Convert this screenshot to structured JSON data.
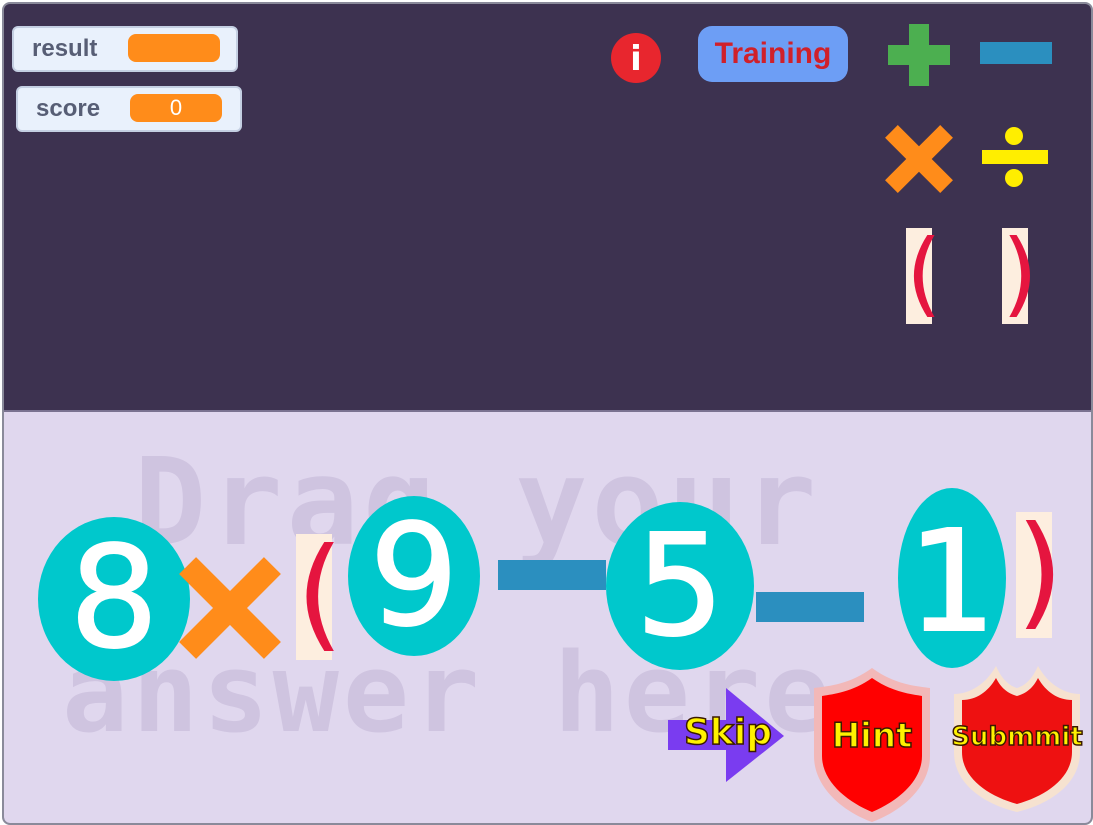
{
  "monitors": {
    "result": {
      "label": "result",
      "value": ""
    },
    "score": {
      "label": "score",
      "value": "0"
    }
  },
  "toolbar": {
    "info_icon": "info-icon",
    "info_glyph": "i",
    "training_label": "Training"
  },
  "palette": {
    "plus": "plus-icon",
    "minus": "minus-icon",
    "multiply": "multiply-icon",
    "divide": "divide-icon",
    "open_paren": "(",
    "close_paren": ")"
  },
  "workspace": {
    "watermark_line1": "Drag your",
    "watermark_line2": "answer here"
  },
  "expression": {
    "tokens": [
      "8",
      "×",
      "(",
      "9",
      "−",
      "5",
      "−",
      "1",
      ")"
    ],
    "digit_1": "8",
    "digit_2": "9",
    "digit_3": "5",
    "digit_4": "1",
    "open_paren": "(",
    "close_paren": ")"
  },
  "actions": {
    "skip_label": "Skip",
    "hint_label": "Hint",
    "submit_label": "Submmit"
  },
  "colors": {
    "stage_top": "#3d3250",
    "stage_bottom": "#e0d7ee",
    "monitor_value": "#ff8c1a",
    "training_bg": "#6d9ef5",
    "training_text": "#d0202a",
    "plus": "#4caf50",
    "minus": "#2b8fbf",
    "multiply": "#ff8c1a",
    "divide": "#ffee00",
    "paren": "#e5153f",
    "digit_bubble": "#00c8cc",
    "hint_shield": "#ff0000",
    "submit_shield": "#ee1111",
    "skip_arrow": "#7a3cf0"
  }
}
